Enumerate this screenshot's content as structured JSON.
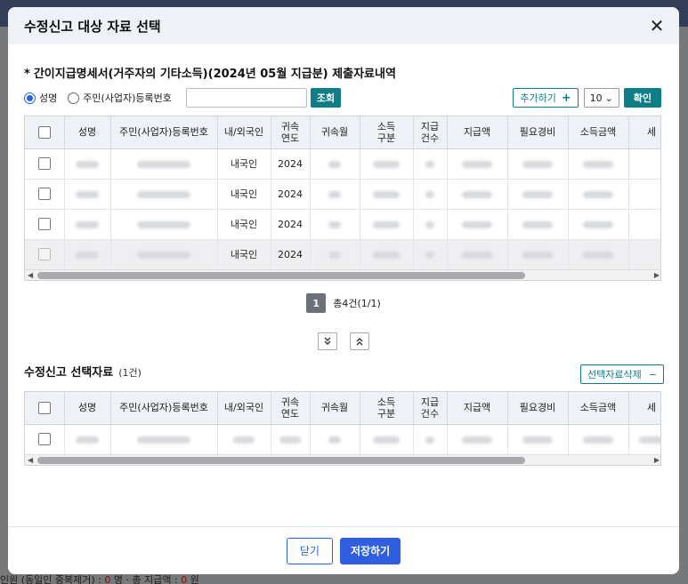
{
  "modal": {
    "title": "수정신고 대상 자료 선택",
    "close_label": "✕"
  },
  "section1": {
    "title": "간이지급명세서(거주자의 기타소득)(2024년 05월 지급분) 제출자료내역",
    "star": "*"
  },
  "filter": {
    "radio_name": "성명",
    "radio_id": "주민(사업자)등록번호",
    "search_value": "",
    "search_button": "조회",
    "add_button": "추가하기",
    "add_plus": "+",
    "page_size": "10",
    "confirm_button": "확인"
  },
  "columns": [
    {
      "l1": "",
      "l2": ""
    },
    {
      "l1": "성명",
      "l2": ""
    },
    {
      "l1": "주민(사업자)등록번호",
      "l2": ""
    },
    {
      "l1": "내/외국인",
      "l2": ""
    },
    {
      "l1": "귀속",
      "l2": "연도"
    },
    {
      "l1": "귀속월",
      "l2": ""
    },
    {
      "l1": "소득",
      "l2": "구분"
    },
    {
      "l1": "지급",
      "l2": "건수"
    },
    {
      "l1": "지급액",
      "l2": ""
    },
    {
      "l1": "필요경비",
      "l2": ""
    },
    {
      "l1": "소득금액",
      "l2": ""
    },
    {
      "l1": "세",
      "l2": ""
    }
  ],
  "rows": [
    {
      "nationality": "내국인",
      "year": "2024",
      "disabled": false
    },
    {
      "nationality": "내국인",
      "year": "2024",
      "disabled": false
    },
    {
      "nationality": "내국인",
      "year": "2024",
      "disabled": false
    },
    {
      "nationality": "내국인",
      "year": "2024",
      "disabled": true
    }
  ],
  "pager": {
    "current_page": "1",
    "total": "총4건(1/1)"
  },
  "section2": {
    "title": "수정신고 선택자료",
    "count": "(1건)",
    "delete_button": "선택자료삭제",
    "delete_minus": "−"
  },
  "selected_rows": [
    {
      "disabled": false
    }
  ],
  "footer": {
    "close_button": "닫기",
    "save_button": "저장하기"
  },
  "background": {
    "footer_text_1": "인원 (동일인 중복제거) : ",
    "footer_zero_1": "0",
    "footer_text_2": " 명   · 총 지급액 : ",
    "footer_zero_2": "0",
    "footer_text_3": " 원"
  },
  "colors": {
    "accent_teal": "#0e7d86",
    "primary_blue": "#2f5fe0"
  }
}
